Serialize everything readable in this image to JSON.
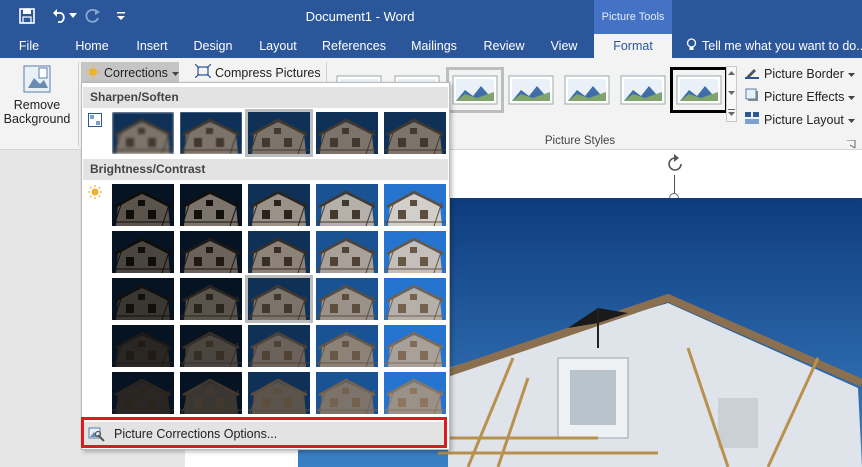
{
  "window": {
    "title": "Document1 - Word",
    "context_header": "Picture Tools"
  },
  "tabs": [
    {
      "label": "File"
    },
    {
      "label": "Home"
    },
    {
      "label": "Insert"
    },
    {
      "label": "Design"
    },
    {
      "label": "Layout"
    },
    {
      "label": "References"
    },
    {
      "label": "Mailings"
    },
    {
      "label": "Review"
    },
    {
      "label": "View"
    },
    {
      "label": "Format"
    }
  ],
  "tell_me": "Tell me what you want to do...",
  "ribbon": {
    "remove_background_line1": "Remove",
    "remove_background_line2": "Background",
    "corrections": "Corrections",
    "compress": "Compress Pictures",
    "picture_border": "Picture Border",
    "picture_effects": "Picture Effects",
    "picture_layout": "Picture Layout",
    "styles_group": "Picture Styles"
  },
  "dropdown": {
    "section1": "Sharpen/Soften",
    "section2": "Brightness/Contrast",
    "options_label": "Picture Corrections Options..."
  },
  "colors": {
    "word_blue": "#2b579a",
    "highlight_red": "#e0191f",
    "sky_blue": "#1e5fa8"
  }
}
